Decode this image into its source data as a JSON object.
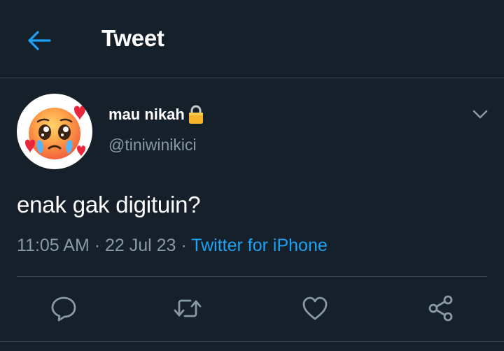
{
  "header": {
    "title": "Tweet"
  },
  "tweet": {
    "author": {
      "display_name": "mau nikah",
      "handle": "@tiniwinikici",
      "protected": true,
      "avatar_icon": "pleading-face-with-hearts-emoji"
    },
    "text": "enak gak digituin?",
    "time": "11:05 AM",
    "date": "22 Jul 23",
    "separator": " · ",
    "source": "Twitter for iPhone"
  },
  "actions": [
    "reply-icon",
    "retweet-icon",
    "like-icon",
    "share-icon"
  ],
  "colors": {
    "background": "#15202b",
    "accent": "#1da1f2",
    "secondary_text": "#8899a6",
    "divider": "#38444d"
  }
}
